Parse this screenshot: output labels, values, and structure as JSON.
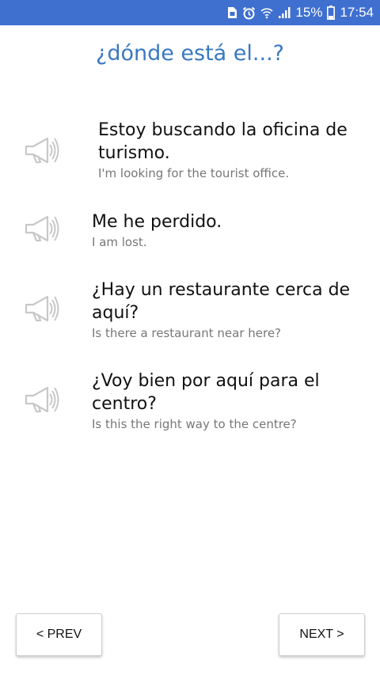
{
  "status_bar": {
    "battery": "15%",
    "time": "17:54",
    "icons": [
      "sim-card-icon",
      "alarm-icon",
      "wifi-icon",
      "signal-icon",
      "battery-icon"
    ]
  },
  "title": "¿dónde está el...?",
  "phrases": [
    {
      "es": "Estoy buscando la oficina de turismo.",
      "en": "I'm looking for the tourist office.",
      "icon": "speaker-icon"
    },
    {
      "es": "Me he perdido.",
      "en": "I am lost.",
      "icon": "speaker-icon"
    },
    {
      "es": "¿Hay un restaurante cerca de aquí?",
      "en": "Is there a restaurant near here?",
      "icon": "speaker-icon"
    },
    {
      "es": "¿Voy bien por aquí para el centro?",
      "en": "Is this the right way to the centre?",
      "icon": "speaker-icon"
    }
  ],
  "nav": {
    "prev_label": "< PREV",
    "next_label": "NEXT >"
  },
  "colors": {
    "status_bar": "#3f6fcf",
    "title": "#3a78c2",
    "translation": "#777777"
  }
}
